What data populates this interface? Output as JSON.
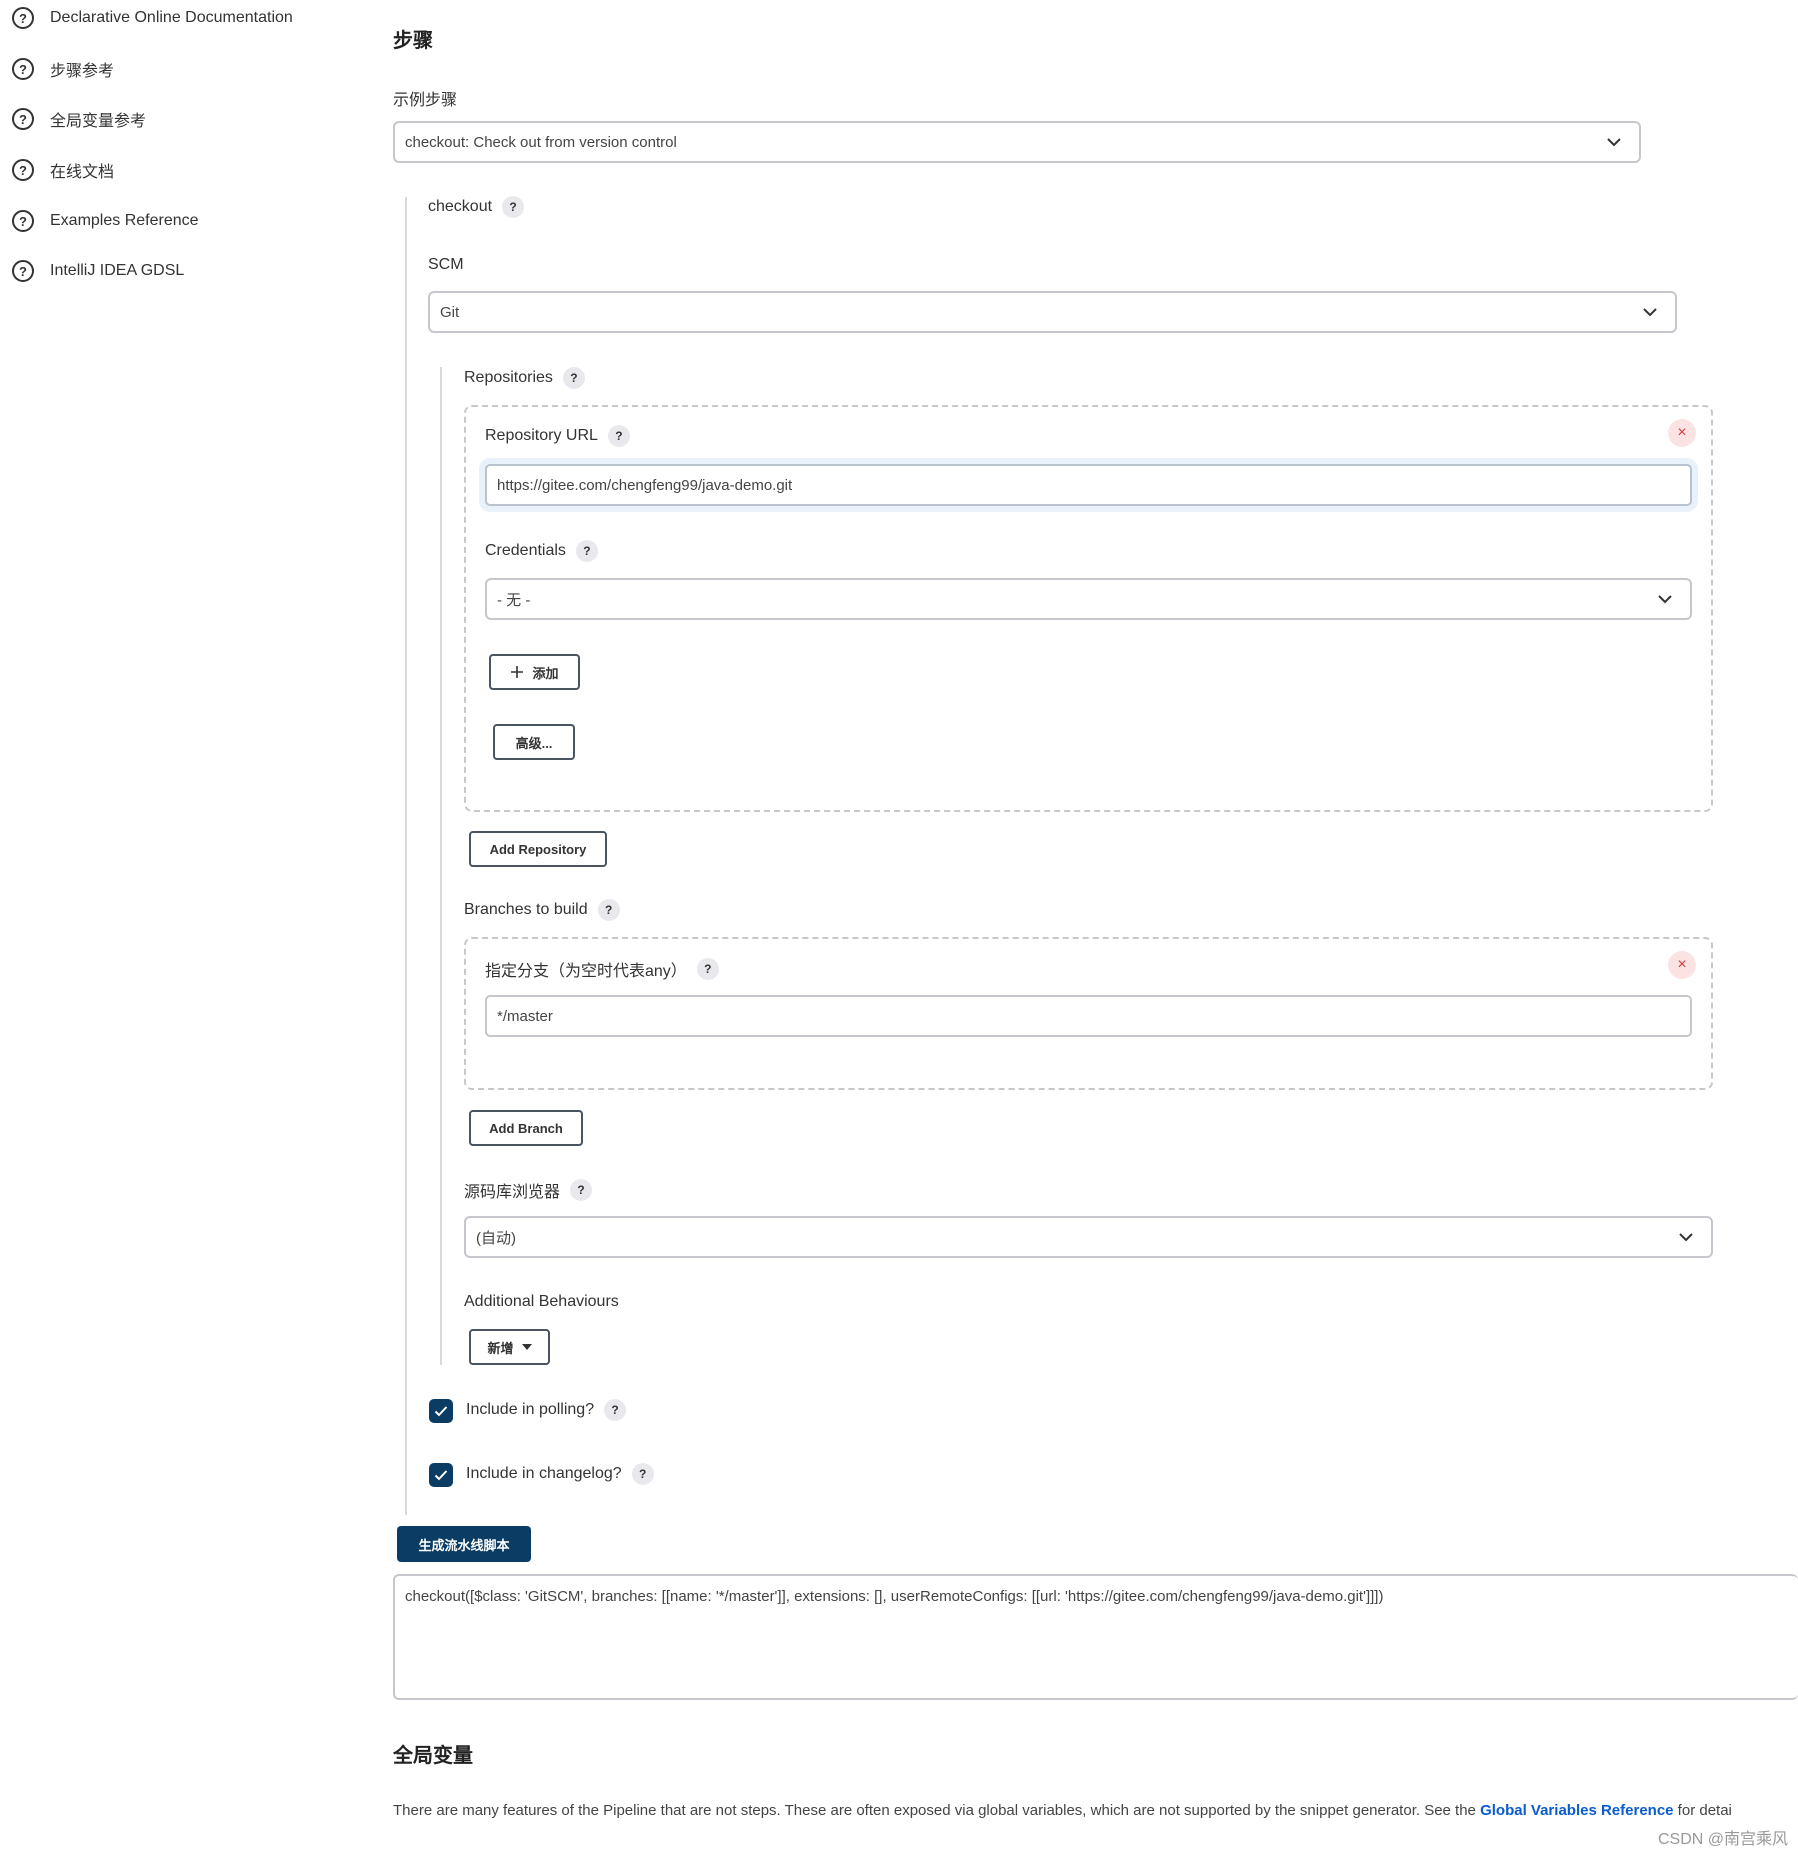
{
  "sidebar": {
    "items": [
      {
        "label": "Declarative Online Documentation",
        "icon": "help-circle-icon"
      },
      {
        "label": "步骤参考",
        "icon": "help-circle-icon"
      },
      {
        "label": "全局变量参考",
        "icon": "help-circle-icon"
      },
      {
        "label": "在线文档",
        "icon": "help-circle-icon"
      },
      {
        "label": "Examples Reference",
        "icon": "help-circle-icon"
      },
      {
        "label": "IntelliJ IDEA GDSL",
        "icon": "help-circle-icon"
      }
    ]
  },
  "steps": {
    "title": "步骤",
    "sample_step_label": "示例步骤",
    "sample_step_value": "checkout: Check out from version control",
    "checkout_label": "checkout",
    "scm_label": "SCM",
    "scm_value": "Git",
    "repositories_label": "Repositories",
    "repository_url_label": "Repository URL",
    "repository_url_value": "https://gitee.com/chengfeng99/java-demo.git",
    "credentials_label": "Credentials",
    "credentials_value": "- 无 -",
    "add_label": "添加",
    "advanced_label": "高级...",
    "add_repository_label": "Add Repository",
    "branches_label": "Branches to build",
    "branch_spec_label": "指定分支（为空时代表any）",
    "branch_spec_value": "*/master",
    "add_branch_label": "Add Branch",
    "repo_browser_label": "源码库浏览器",
    "repo_browser_value": "(自动)",
    "additional_behaviours_label": "Additional Behaviours",
    "new_label": "新增",
    "include_polling_label": "Include in polling?",
    "include_polling_checked": true,
    "include_changelog_label": "Include in changelog?",
    "include_changelog_checked": true,
    "help_glyph": "?",
    "close_glyph": "×"
  },
  "generate": {
    "button_label": "生成流水线脚本",
    "script": "checkout([$class: 'GitSCM', branches: [[name: '*/master']], extensions: [], userRemoteConfigs: [[url: 'https://gitee.com/chengfeng99/java-demo.git']]])"
  },
  "global_vars": {
    "title": "全局变量",
    "text_before": "There are many features of the Pipeline that are not steps. These are often exposed via global variables, which are not supported by the snippet generator. See the ",
    "link_text": "Global Variables Reference",
    "text_after": " for detai"
  },
  "watermark": "CSDN @南宫乘风",
  "colors": {
    "primary": "#0b3c63",
    "link": "#0b5ccd",
    "close": "#d53b3b"
  }
}
